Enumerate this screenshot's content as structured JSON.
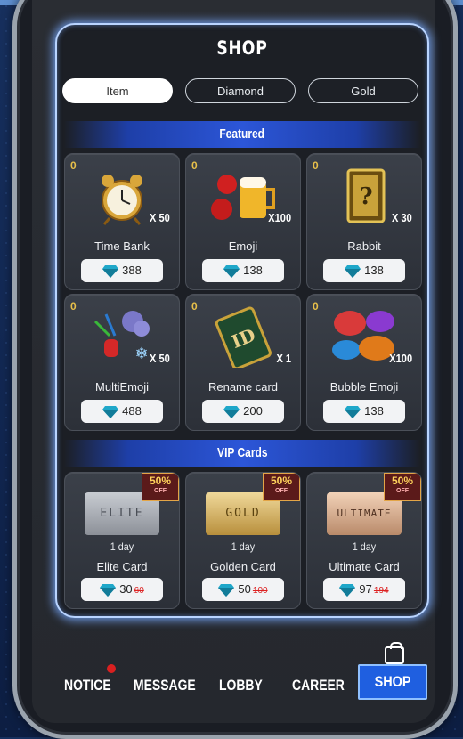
{
  "header": {
    "title": "SHOP"
  },
  "tabs": [
    {
      "label": "Item",
      "active": true
    },
    {
      "label": "Diamond",
      "active": false
    },
    {
      "label": "Gold",
      "active": false
    }
  ],
  "sections": {
    "featured": "Featured",
    "vip": "VIP Cards"
  },
  "featured_items": [
    {
      "badge": "0",
      "qty": "X 50",
      "name": "Time Bank",
      "price": "388",
      "icon": "alarm-clock-icon"
    },
    {
      "badge": "0",
      "qty": "X100",
      "name": "Emoji",
      "price": "138",
      "icon": "boxing-beer-icon"
    },
    {
      "badge": "0",
      "qty": "X 30",
      "name": "Rabbit",
      "price": "138",
      "icon": "mystery-card-icon"
    },
    {
      "badge": "0",
      "qty": "X 50",
      "name": "MultiEmoji",
      "price": "488",
      "icon": "fireworks-icon"
    },
    {
      "badge": "0",
      "qty": "X 1",
      "name": "Rename card",
      "price": "200",
      "icon": "id-card-icon"
    },
    {
      "badge": "0",
      "qty": "X100",
      "name": "Bubble Emoji",
      "price": "138",
      "icon": "speech-bubbles-icon"
    }
  ],
  "vip_items": [
    {
      "card_text": "ELITE",
      "days": "1 day",
      "name": "Elite Card",
      "price": "30",
      "old_price": "60",
      "discount": "50%",
      "discount_sub": "OFF"
    },
    {
      "card_text": "GOLD",
      "days": "1 day",
      "name": "Golden Card",
      "price": "50",
      "old_price": "100",
      "discount": "50%",
      "discount_sub": "OFF"
    },
    {
      "card_text": "ULTIMATE",
      "days": "1 day",
      "name": "Ultimate Card",
      "price": "97",
      "old_price": "194",
      "discount": "50%",
      "discount_sub": "OFF"
    }
  ],
  "bottom_nav": [
    {
      "label": "NOTICE",
      "active": false
    },
    {
      "label": "MESSAGE",
      "active": false
    },
    {
      "label": "LOBBY",
      "active": false
    },
    {
      "label": "CAREER",
      "active": false
    },
    {
      "label": "SHOP",
      "active": true
    }
  ],
  "colors": {
    "accent": "#1f5fe0",
    "panel_glow": "#b9d4ff",
    "badge_gold": "#e8c04a",
    "discount_red": "#d22222"
  }
}
